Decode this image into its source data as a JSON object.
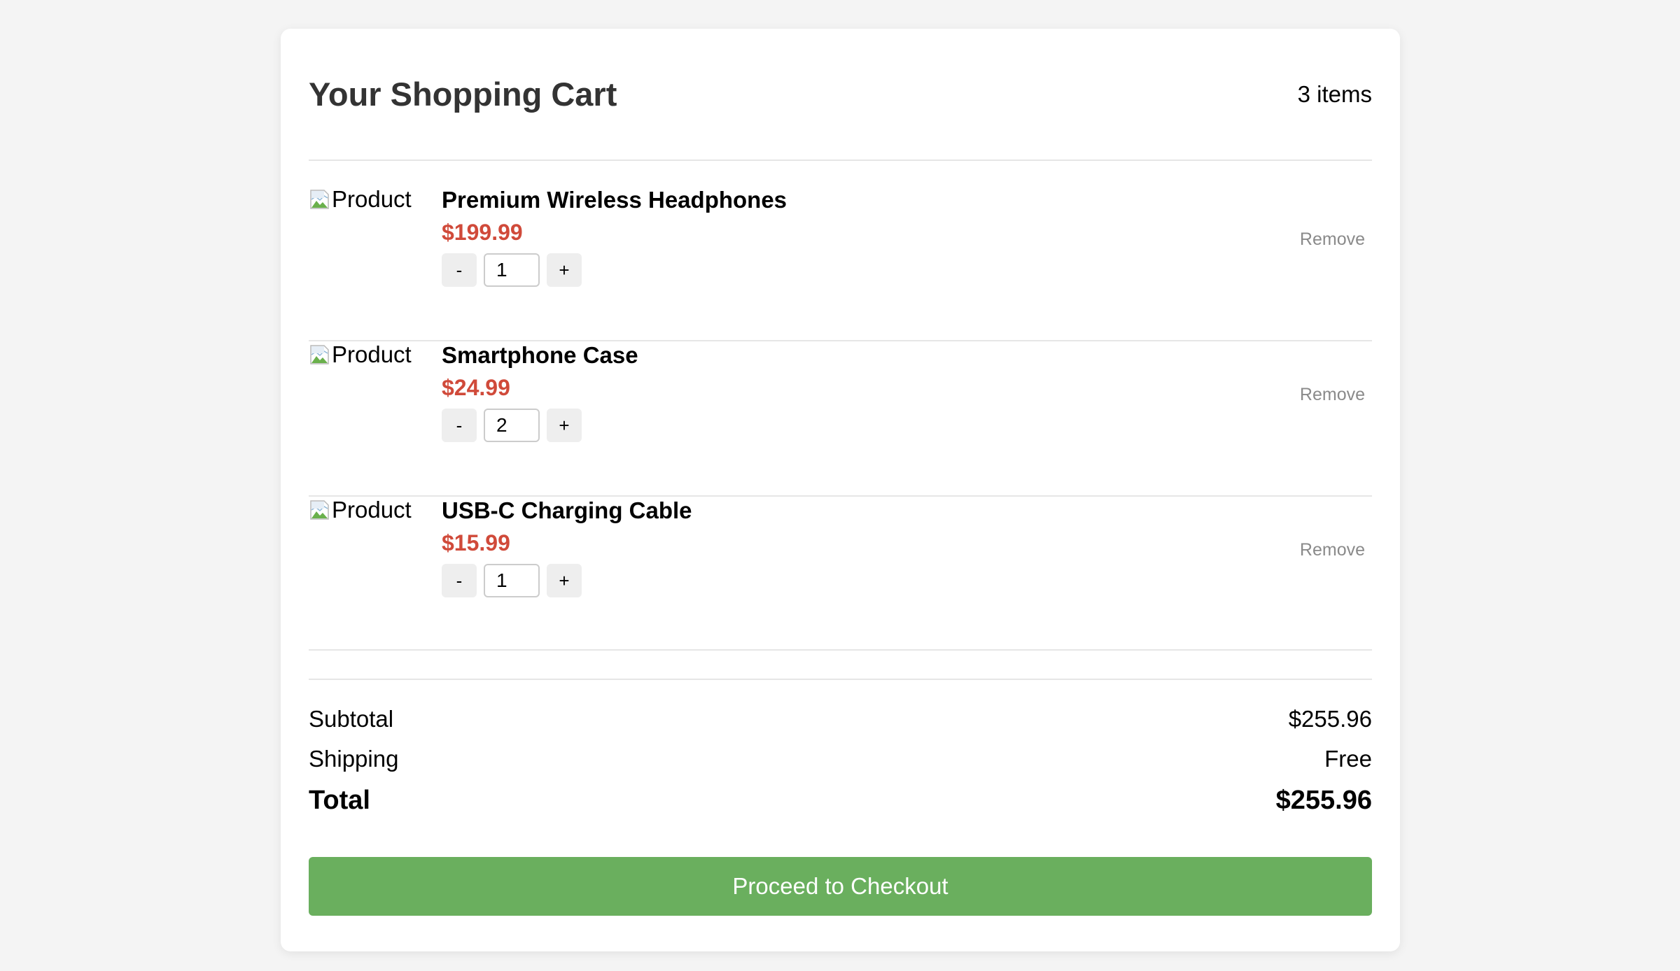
{
  "cart": {
    "title": "Your Shopping Cart",
    "item_count": "3 items",
    "items": [
      {
        "image_alt": "Product",
        "name": "Premium Wireless Headphones",
        "price": "$199.99",
        "quantity": "1",
        "decrement_label": "-",
        "increment_label": "+",
        "remove_label": "Remove"
      },
      {
        "image_alt": "Product",
        "name": "Smartphone Case",
        "price": "$24.99",
        "quantity": "2",
        "decrement_label": "-",
        "increment_label": "+",
        "remove_label": "Remove"
      },
      {
        "image_alt": "Product",
        "name": "USB-C Charging Cable",
        "price": "$15.99",
        "quantity": "1",
        "decrement_label": "-",
        "increment_label": "+",
        "remove_label": "Remove"
      }
    ]
  },
  "summary": {
    "subtotal_label": "Subtotal",
    "subtotal_value": "$255.96",
    "shipping_label": "Shipping",
    "shipping_value": "Free",
    "total_label": "Total",
    "total_value": "$255.96"
  },
  "checkout": {
    "label": "Proceed to Checkout"
  },
  "colors": {
    "background": "#f4f4f4",
    "card": "#ffffff",
    "price": "#d04a3a",
    "checkout_button": "#6aaf5e",
    "remove_text": "#8a8a8a"
  },
  "icons": {
    "product_image": "broken-image-icon"
  }
}
